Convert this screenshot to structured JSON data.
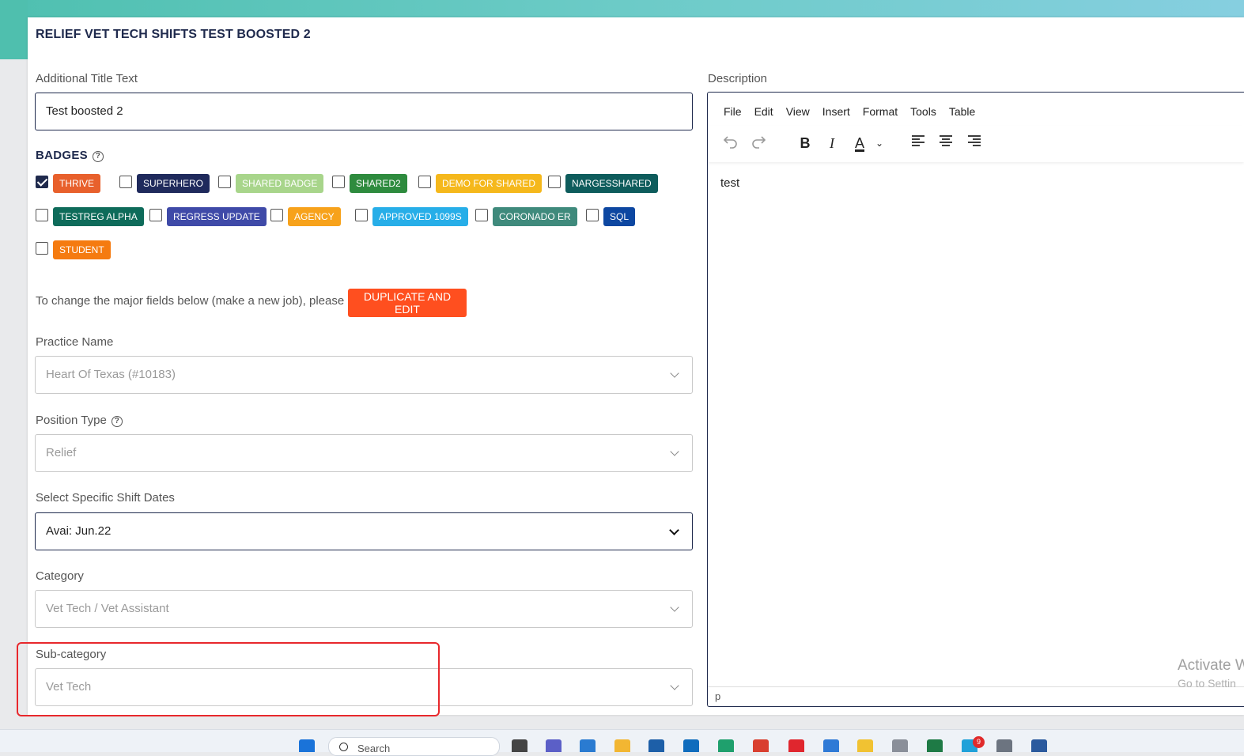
{
  "modal": {
    "title": "RELIEF VET TECH SHIFTS TEST BOOSTED 2",
    "additional_title": {
      "label": "Additional Title Text",
      "value": "Test boosted 2"
    },
    "badges_label": "BADGES",
    "badges": [
      {
        "label": "THRIVE",
        "checked": true,
        "color": "#e8602c"
      },
      {
        "label": "SUPERHERO",
        "checked": false,
        "color": "#1f2a5c"
      },
      {
        "label": "SHARED BADGE",
        "checked": false,
        "color": "#a8d58b"
      },
      {
        "label": "SHARED2",
        "checked": false,
        "color": "#2e8b3e"
      },
      {
        "label": "DEMO FOR SHARED",
        "checked": false,
        "color": "#f5b81c"
      },
      {
        "label": "NARGESSHARED",
        "checked": false,
        "color": "#0e5c5c"
      },
      {
        "label": "TESTREG ALPHA",
        "checked": false,
        "color": "#0e6b5a"
      },
      {
        "label": "REGRESS UPDATE",
        "checked": false,
        "color": "#3f4aa8"
      },
      {
        "label": "AGENCY",
        "checked": false,
        "color": "#f7a21b"
      },
      {
        "label": "APPROVED 1099S",
        "checked": false,
        "color": "#27aee8"
      },
      {
        "label": "CORONADO ER",
        "checked": false,
        "color": "#3f8a7c"
      },
      {
        "label": "SQL",
        "checked": false,
        "color": "#0d47a1"
      },
      {
        "label": "STUDENT",
        "checked": false,
        "color": "#f57b10"
      }
    ],
    "duplicate_text": "To change the major fields below (make a new job), please",
    "duplicate_button": "DUPLICATE AND EDIT",
    "practice": {
      "label": "Practice Name",
      "value": "Heart Of Texas (#10183)"
    },
    "position": {
      "label": "Position Type",
      "value": "Relief"
    },
    "shift_dates": {
      "label": "Select Specific Shift Dates",
      "value": "Avai: Jun.22"
    },
    "category": {
      "label": "Category",
      "value": "Vet Tech / Vet Assistant"
    },
    "subcategory": {
      "label": "Sub-category",
      "value": "Vet Tech"
    },
    "description": {
      "label": "Description",
      "menu": [
        "File",
        "Edit",
        "View",
        "Insert",
        "Format",
        "Tools",
        "Table"
      ],
      "content": "test",
      "status": "p"
    }
  },
  "watermark": {
    "line1": "Activate W",
    "line2": "Go to Settin"
  },
  "taskbar": {
    "search_placeholder": "Search",
    "notification_count": "9"
  }
}
